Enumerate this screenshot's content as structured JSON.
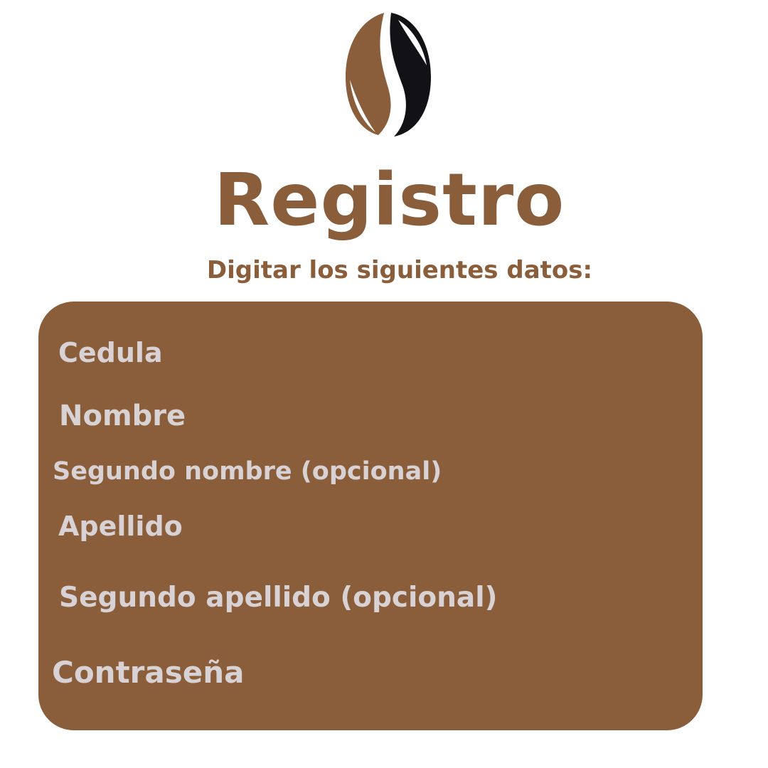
{
  "header": {
    "title": "Registro",
    "subtitle": "Digitar los siguientes datos:",
    "logo_icon": "coffee-bean-icon"
  },
  "form": {
    "fields": [
      {
        "label": "Cedula"
      },
      {
        "label": "Nombre"
      },
      {
        "label": "Segundo nombre (opcional)"
      },
      {
        "label": "Apellido"
      },
      {
        "label": "Segundo apellido (opcional)"
      },
      {
        "label": "Contraseña"
      }
    ]
  },
  "colors": {
    "brand_brown": "#8a5d3b",
    "bean_dark": "#121115",
    "label_text": "#d8d2d4",
    "background": "#ffffff"
  }
}
